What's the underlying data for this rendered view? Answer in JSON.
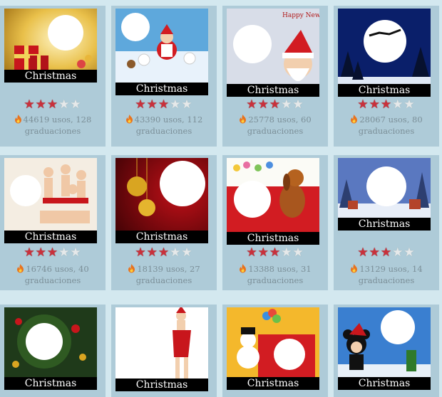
{
  "cards": [
    {
      "label": "Christmas",
      "stats": "44619 usos, 128 graduaciones",
      "rating": 3
    },
    {
      "label": "Christmas",
      "stats": "43390 usos, 112 graduaciones",
      "rating": 3
    },
    {
      "label": "Christmas",
      "stats": "25778 usos, 60 graduaciones",
      "rating": 3
    },
    {
      "label": "Christmas",
      "stats": "28067 usos, 80 graduaciones",
      "rating": 3
    },
    {
      "label": "Christmas",
      "stats": "16746 usos, 40 graduaciones",
      "rating": 3
    },
    {
      "label": "Christmas",
      "stats": "18139 usos, 27 graduaciones",
      "rating": 3
    },
    {
      "label": "Christmas",
      "stats": "13388 usos, 31 graduaciones",
      "rating": 3
    },
    {
      "label": "Christmas",
      "stats": "13129 usos, 14 graduaciones",
      "rating": 3
    },
    {
      "label": "Christmas"
    },
    {
      "label": "Christmas"
    },
    {
      "label": "Christmas"
    },
    {
      "label": "Christmas"
    }
  ],
  "thumb3_caption": "Happy New Year",
  "icons": {
    "star": "star-icon",
    "fire": "fire-icon"
  },
  "colors": {
    "star_on": "#c9303b",
    "star_off": "#e6e9ea",
    "card_bg": "#aecbd8",
    "page_bg": "#d3e8ef"
  }
}
